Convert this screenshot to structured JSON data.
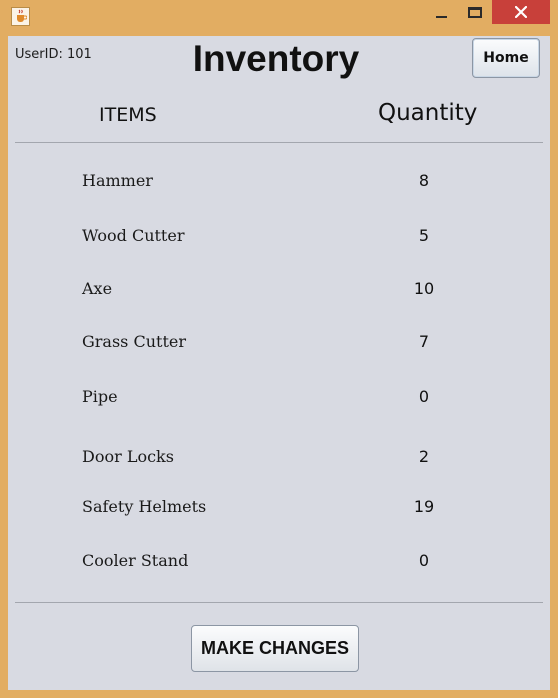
{
  "window": {
    "icons": {
      "app": "java-cup-icon",
      "minimize": "minimize-icon",
      "maximize": "maximize-icon",
      "close": "close-icon"
    }
  },
  "header": {
    "user_label": "UserID: 101",
    "title": "Inventory",
    "home_label": "Home"
  },
  "table": {
    "col_items": "ITEMS",
    "col_quantity": "Quantity",
    "rows": [
      {
        "name": "Hammer",
        "quantity": "8"
      },
      {
        "name": "Wood Cutter",
        "quantity": "5"
      },
      {
        "name": "Axe",
        "quantity": "10"
      },
      {
        "name": "Grass Cutter",
        "quantity": "7"
      },
      {
        "name": "Pipe",
        "quantity": "0"
      },
      {
        "name": "Door Locks",
        "quantity": "2"
      },
      {
        "name": "Safety Helmets",
        "quantity": "19"
      },
      {
        "name": "Cooler Stand",
        "quantity": "0"
      }
    ]
  },
  "footer": {
    "make_changes_label": "MAKE CHANGES"
  },
  "colors": {
    "frame": "#e2ad62",
    "client": "#d8dae2",
    "close": "#c8403a"
  }
}
